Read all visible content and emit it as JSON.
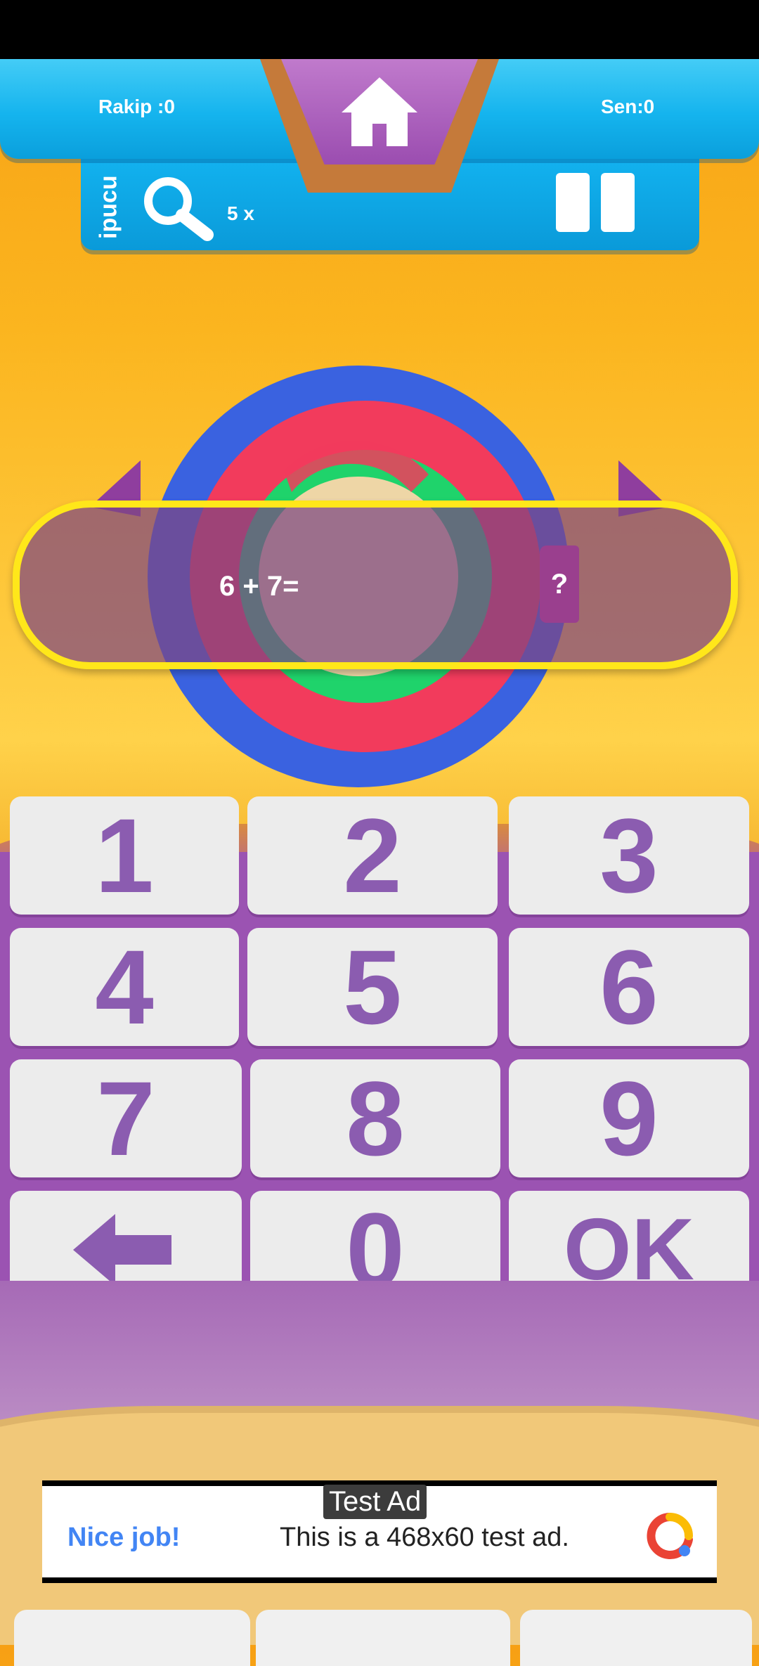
{
  "header": {
    "opponent_score": "Rakip :0",
    "player_score": "Sen:0",
    "home_icon": "home-icon"
  },
  "hint": {
    "label": "ipucu",
    "icon": "magnifier-icon",
    "count": "5 x",
    "pause_icon": "pause-icon"
  },
  "question": {
    "equation": "6 + 7=",
    "answer_mark": "?"
  },
  "keypad": {
    "keys": [
      "1",
      "2",
      "3",
      "4",
      "5",
      "6",
      "7",
      "8",
      "9",
      "←",
      "0",
      "OK"
    ],
    "backspace_icon": "left-arrow-icon"
  },
  "ad": {
    "tag": "Test Ad",
    "headline": "Nice job!",
    "text": "This is a 468x60 test ad.",
    "logo_icon": "admob-logo-icon"
  },
  "colors": {
    "accent_purple": "#8b5cb0",
    "header_blue": "#15b4ee",
    "banner_yellow": "#ffe71a",
    "bg_orange": "#fbb51f"
  }
}
